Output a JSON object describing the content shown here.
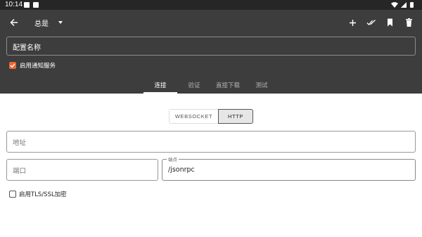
{
  "status_bar": {
    "time": "10:14",
    "left_icons": [
      "image-notification-icon",
      "download-notification-icon"
    ],
    "right_icons": [
      "wifi-icon",
      "signal-icon",
      "battery-icon"
    ]
  },
  "app_bar": {
    "title": "总是",
    "actions": [
      "add-icon",
      "done-all-icon",
      "bookmark-icon",
      "delete-icon"
    ]
  },
  "config_name": {
    "placeholder": "配置名称",
    "value": ""
  },
  "notification": {
    "label": "启用通知服务",
    "checked": true
  },
  "tabs": [
    {
      "label": "连接",
      "active": true
    },
    {
      "label": "验证",
      "active": false
    },
    {
      "label": "直接下载",
      "active": false
    },
    {
      "label": "测试",
      "active": false
    }
  ],
  "protocol": {
    "options": [
      "WEBSOCKET",
      "HTTP"
    ],
    "selected": "HTTP"
  },
  "address": {
    "placeholder": "地址",
    "value": ""
  },
  "port": {
    "placeholder": "端口",
    "value": ""
  },
  "endpoint": {
    "label": "端点",
    "value": "/jsonrpc"
  },
  "tls": {
    "label": "启用TLS/SSL加密",
    "checked": false
  },
  "colors": {
    "status_bar": "#262626",
    "app_bar": "#3d3d3d",
    "accent": "#ef6633",
    "background": "#ffffff"
  }
}
